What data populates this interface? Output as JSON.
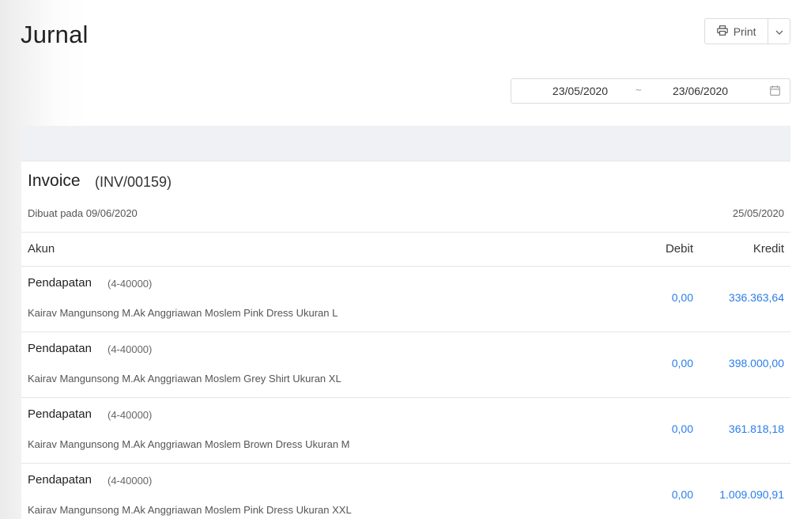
{
  "page": {
    "title": "Jurnal"
  },
  "toolbar": {
    "print_label": "Print"
  },
  "filter": {
    "date_from": "23/05/2020",
    "separator": "~",
    "date_to": "23/06/2020"
  },
  "invoice": {
    "title": "Invoice",
    "number": "(INV/00159)",
    "created": "Dibuat pada 09/06/2020",
    "date": "25/05/2020"
  },
  "table": {
    "headers": {
      "account": "Akun",
      "debit": "Debit",
      "credit": "Kredit"
    },
    "rows": [
      {
        "account": "Pendapatan",
        "code": "(4-40000)",
        "description": "Kairav Mangunsong M.Ak Anggriawan Moslem Pink Dress Ukuran L",
        "debit": "0,00",
        "credit": "336.363,64"
      },
      {
        "account": "Pendapatan",
        "code": "(4-40000)",
        "description": "Kairav Mangunsong M.Ak Anggriawan Moslem Grey Shirt Ukuran XL",
        "debit": "0,00",
        "credit": "398.000,00"
      },
      {
        "account": "Pendapatan",
        "code": "(4-40000)",
        "description": "Kairav Mangunsong M.Ak Anggriawan Moslem Brown Dress Ukuran M",
        "debit": "0,00",
        "credit": "361.818,18"
      },
      {
        "account": "Pendapatan",
        "code": "(4-40000)",
        "description": "Kairav Mangunsong M.Ak Anggriawan Moslem Pink Dress Ukuran XXL",
        "debit": "0,00",
        "credit": "1.009.090,91"
      }
    ]
  },
  "colors": {
    "link": "#2b7de9",
    "band": "#f0f1f5",
    "border": "#e6e6e6"
  },
  "icons": {
    "print": "printer-icon",
    "caret": "chevron-down-icon",
    "calendar": "calendar-icon"
  }
}
